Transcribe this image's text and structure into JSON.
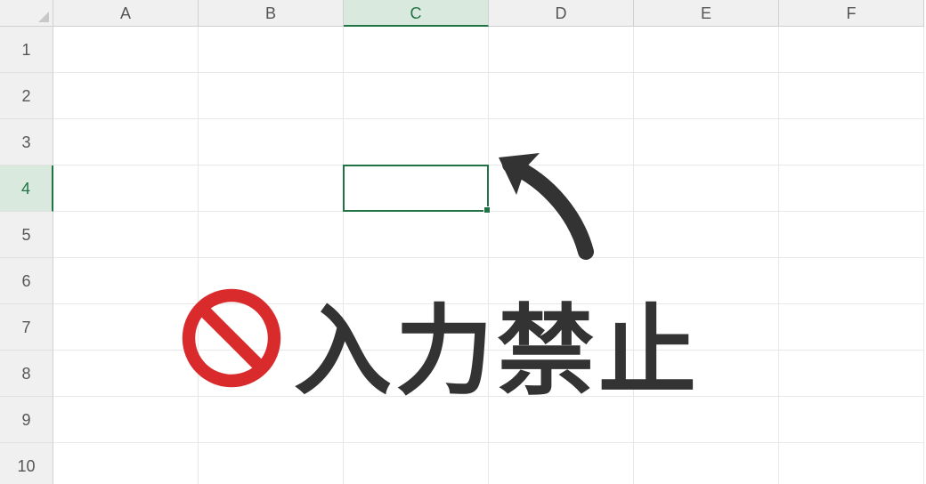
{
  "columns": [
    "A",
    "B",
    "C",
    "D",
    "E",
    "F"
  ],
  "rows": [
    "1",
    "2",
    "3",
    "4",
    "5",
    "6",
    "7",
    "8",
    "9",
    "10"
  ],
  "activeColumnIndex": 2,
  "activeRowIndex": 3,
  "selectedCell": "C4",
  "annotation": {
    "text": "入力禁止",
    "iconName": "prohibition-icon",
    "iconColor": "#d92b2b",
    "arrowColor": "#333333"
  }
}
